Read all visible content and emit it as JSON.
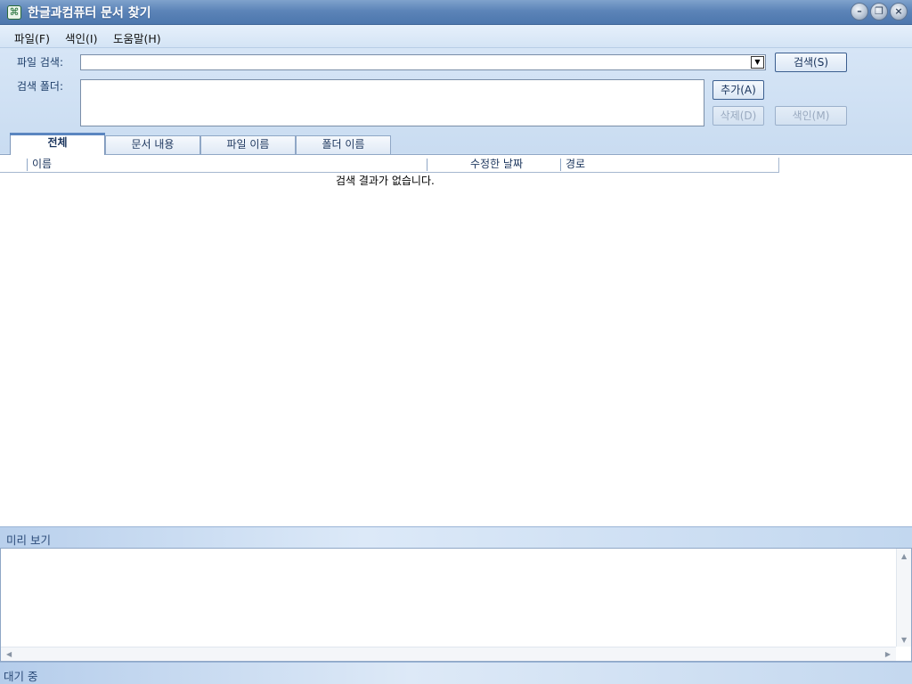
{
  "window": {
    "title": "한글과컴퓨터 문서 찾기",
    "app_icon": "hangul-icon"
  },
  "menu": [
    {
      "label": "파일(F)"
    },
    {
      "label": "색인(I)"
    },
    {
      "label": "도움말(H)"
    }
  ],
  "search": {
    "file_label": "파일 검색:",
    "file_value": "",
    "folder_label": "검색 폴더:",
    "search_button": "검색(S)",
    "add_button": "추가(A)",
    "delete_button": "삭제(D)",
    "index_button": "색인(M)"
  },
  "tabs": [
    {
      "label": "전체",
      "active": true
    },
    {
      "label": "문서 내용",
      "active": false
    },
    {
      "label": "파일 이름",
      "active": false
    },
    {
      "label": "폴더 이름",
      "active": false
    }
  ],
  "results": {
    "columns": [
      "이름",
      "수정한 날짜",
      "경로"
    ],
    "empty_message": "검색 결과가 없습니다."
  },
  "preview": {
    "label": "미리 보기"
  },
  "status": {
    "text": "대기 중"
  }
}
